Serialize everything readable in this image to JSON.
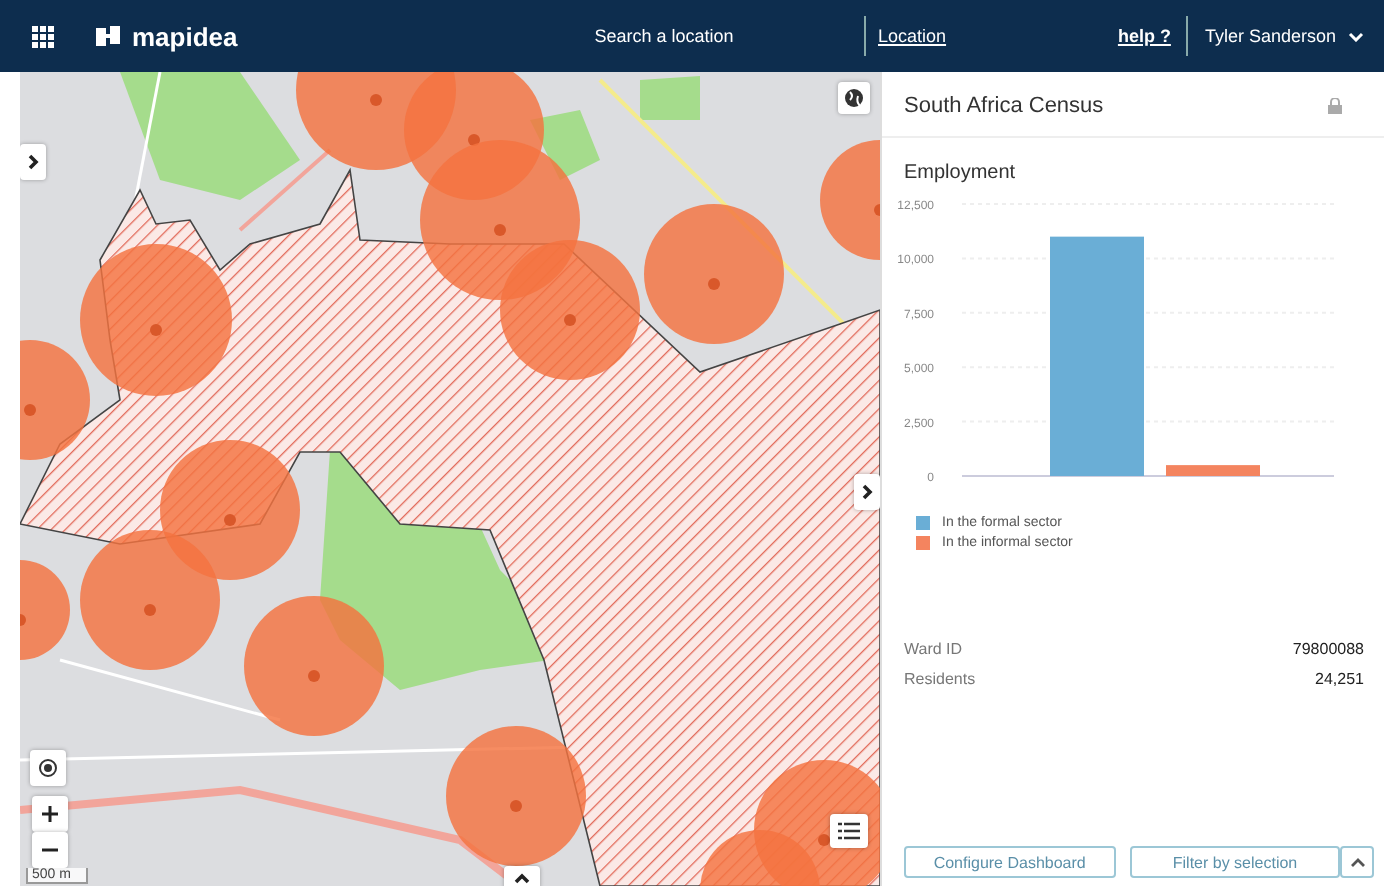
{
  "header": {
    "logo": "mapidea",
    "search": {
      "placeholder": "Search a location"
    },
    "location_link": "Location",
    "help_link": "help ?",
    "user": "Tyler Sanderson"
  },
  "map": {
    "scale": "500 m"
  },
  "panel": {
    "title": "South Africa Census",
    "locked": true,
    "widget": {
      "title": "Employment",
      "chart_data": {
        "type": "bar",
        "grid": true,
        "ylim": [
          0,
          12500
        ],
        "yticks": [
          {
            "value": 0,
            "label": "0"
          },
          {
            "value": 2500,
            "label": "2,500"
          },
          {
            "value": 5000,
            "label": "5,000"
          },
          {
            "value": 7500,
            "label": "7,500"
          },
          {
            "value": 10000,
            "label": "10,000"
          },
          {
            "value": 12500,
            "label": "12,500"
          }
        ],
        "series": [
          {
            "name": "In the formal sector",
            "color": "#6aaed6",
            "values": [
              11000
            ]
          },
          {
            "name": "In the informal sector",
            "color": "#f4845f",
            "values": [
              500
            ]
          }
        ]
      }
    },
    "fields": [
      {
        "label": "Ward ID",
        "value": "79800088"
      },
      {
        "label": "Residents",
        "value": "24,251"
      }
    ],
    "buttons": [
      "Configure Dashboard",
      "Filter by selection"
    ]
  }
}
